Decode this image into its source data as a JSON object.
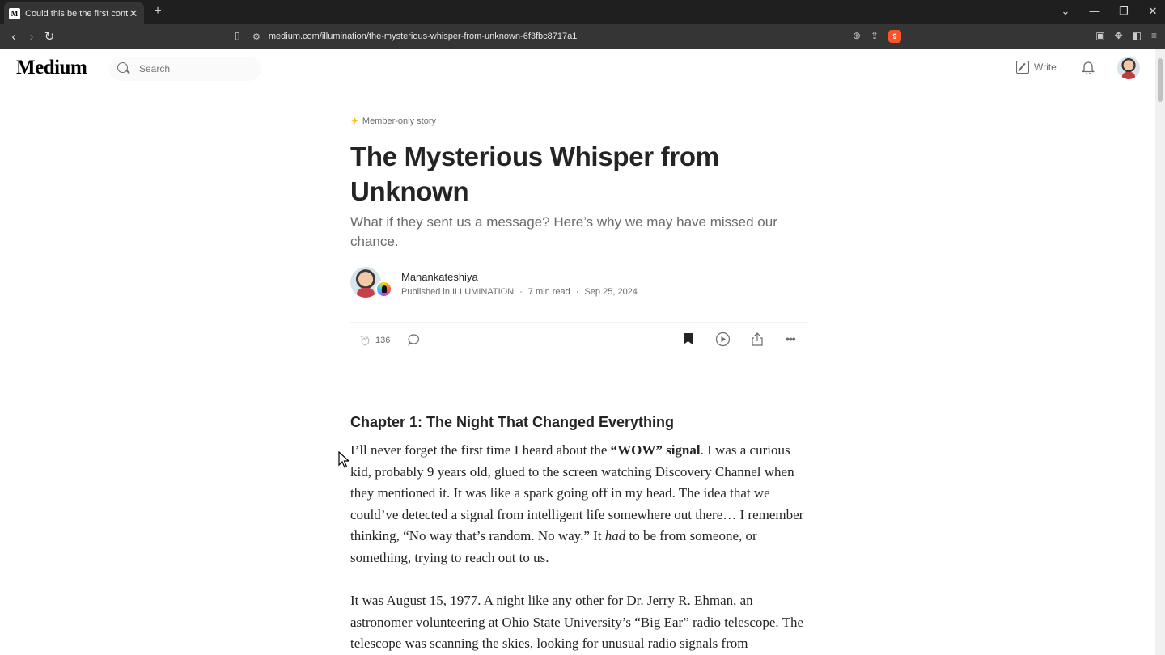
{
  "browser": {
    "tab_title": "Could this be the first contact w",
    "tab_favicon": "M",
    "url": "medium.com/illumination/the-mysterious-whisper-from-unknown-6f3fbc8717a1",
    "brave_badge": "9"
  },
  "header": {
    "logo": "Medium",
    "search_placeholder": "Search",
    "write_label": "Write"
  },
  "article": {
    "member_label": "Member-only story",
    "title": "The Mysterious Whisper from Unknown",
    "subtitle": "What if they sent us a message? Here’s why we may have missed our chance.",
    "author": "Manankateshiya",
    "published_in_prefix": "Published in",
    "publication": "ILLUMINATION",
    "read_time": "7 min read",
    "date": "Sep 25, 2024",
    "claps": "136",
    "chapter_heading": "Chapter 1: The Night That Changed Everything",
    "p1_a": "I’ll never forget the first time I heard about the ",
    "p1_bold": "“WOW” signal",
    "p1_b": ". I was a curious kid, probably 9 years old, glued to the screen watching Discovery Channel when they mentioned it. It was like a spark going off in my head. The idea that we could’ve detected a signal from intelligent life somewhere out there… I remember thinking, “No way that’s random. No way.” It ",
    "p1_italic": "had",
    "p1_c": " to be from someone, or something, trying to reach out to us.",
    "p2": "It was August 15, 1977. A night like any other for Dr. Jerry R. Ehman, an astronomer volunteering at Ohio State University’s “Big Ear” radio telescope. The telescope was scanning the skies, looking for unusual radio signals from"
  },
  "colors": {
    "text": "#242424",
    "muted": "#6b6b6b",
    "member_star": "#ffc017",
    "chrome_dark": "#1f1f1f",
    "chrome_toolbar": "#353535"
  },
  "icons": [
    "back-icon",
    "forward-icon",
    "reload-icon",
    "bookmark-icon",
    "search-icon",
    "write-icon",
    "bell-icon",
    "clap-icon",
    "comment-icon",
    "save-icon",
    "listen-icon",
    "share-icon",
    "more-icon"
  ]
}
